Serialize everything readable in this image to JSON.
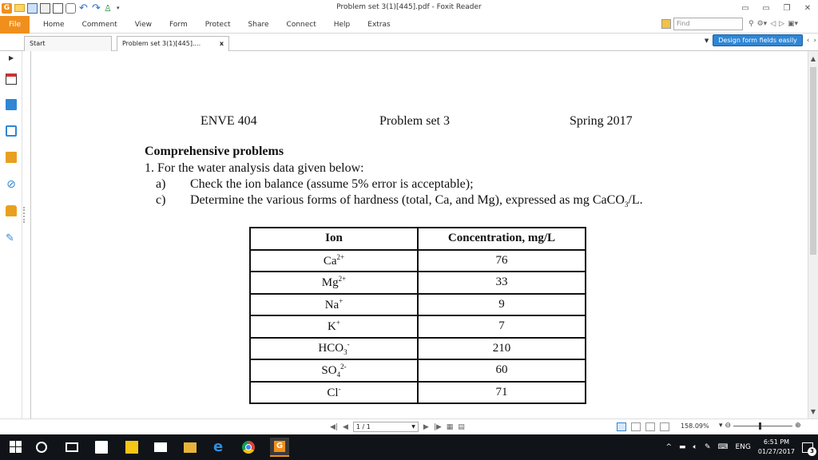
{
  "window": {
    "title": "Problem set 3(1)[445].pdf - Foxit Reader"
  },
  "ribbon": {
    "tabs": [
      "File",
      "Home",
      "Comment",
      "View",
      "Form",
      "Protect",
      "Share",
      "Connect",
      "Help",
      "Extras"
    ],
    "find_placeholder": "Find"
  },
  "doc_tabs": {
    "start": "Start",
    "document": "Problem set 3(1)[445]....",
    "close": "x"
  },
  "design_button": "Design form fields easily",
  "document": {
    "course": "ENVE 404",
    "set": "Problem set 3",
    "term": "Spring 2017",
    "section_title": "Comprehensive problems",
    "problem": "1. For the water analysis data given below:",
    "item_a_label": "a)",
    "item_a": "Check the ion balance (assume 5% error is acceptable);",
    "item_c_label": "c)",
    "item_c_pre": "Determine the various forms of hardness (total, Ca, and Mg), expressed as mg CaCO",
    "item_c_sub": "3",
    "item_c_post": "/L.",
    "table": {
      "headers": [
        "Ion",
        "Concentration, mg/L"
      ],
      "rows": [
        {
          "base": "Ca",
          "sub": "",
          "sup": "2+",
          "value": "76"
        },
        {
          "base": "Mg",
          "sub": "",
          "sup": "2+",
          "value": "33"
        },
        {
          "base": "Na",
          "sub": "",
          "sup": "+",
          "value": "9"
        },
        {
          "base": "K",
          "sub": "",
          "sup": "+",
          "value": "7"
        },
        {
          "base": "HCO",
          "sub": "3",
          "sup": "-",
          "value": "210"
        },
        {
          "base": "SO",
          "sub": "4",
          "sup": "2-",
          "value": "60"
        },
        {
          "base": "Cl",
          "sub": "",
          "sup": "-",
          "value": "71"
        }
      ]
    }
  },
  "status": {
    "page": "1 / 1",
    "zoom": "158.09%"
  },
  "taskbar": {
    "lang": "ENG",
    "time": "6:51 PM",
    "date": "01/27/2017",
    "notifications": "3"
  }
}
